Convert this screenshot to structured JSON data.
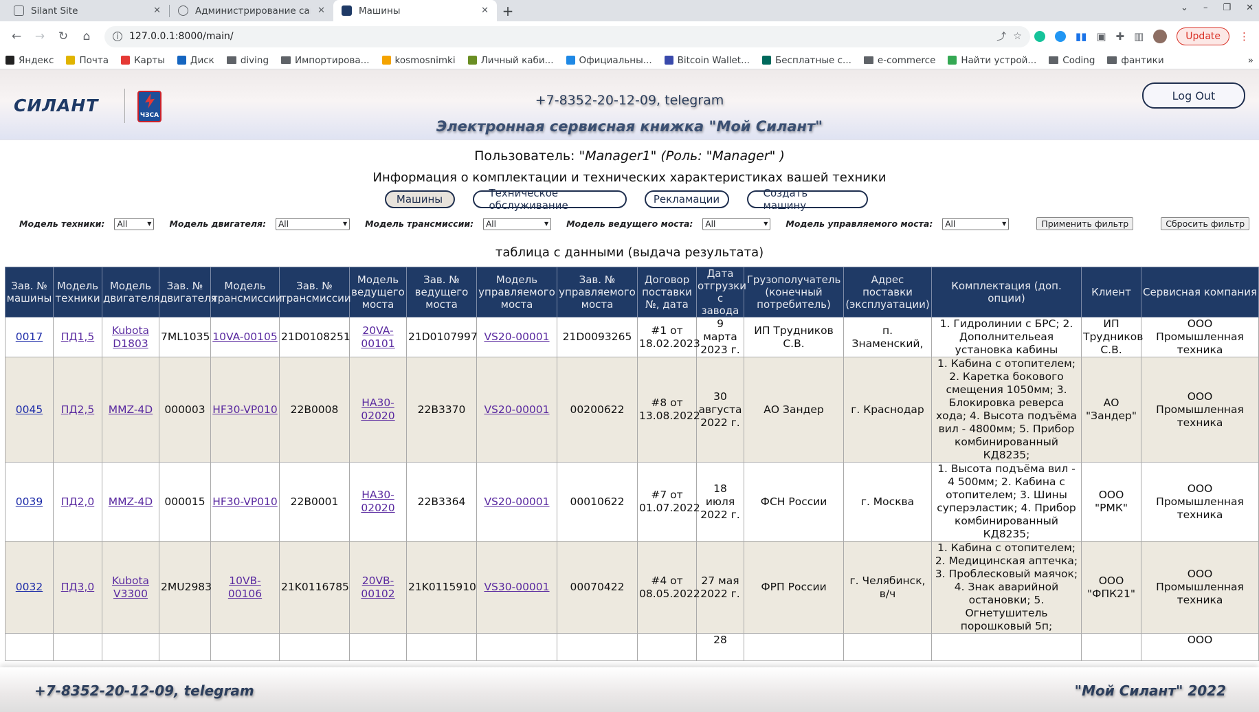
{
  "browser": {
    "tabs": [
      {
        "title": "Silant Site",
        "favicon": "document-icon",
        "active": false
      },
      {
        "title": "Администрирование сайта",
        "favicon": "globe-icon",
        "active": false
      },
      {
        "title": "Машины",
        "favicon": "silant-icon",
        "active": true
      }
    ],
    "url": "127.0.0.1:8000/main/",
    "update_label": "Update",
    "bookmarks": [
      {
        "label": "Яндекс",
        "color": "#222"
      },
      {
        "label": "Почта",
        "color": "#e0b400"
      },
      {
        "label": "Карты",
        "color": "#e53935"
      },
      {
        "label": "Диск",
        "color": "#1565c0"
      },
      {
        "label": "diving",
        "color": "folder"
      },
      {
        "label": "Импортирова...",
        "color": "folder"
      },
      {
        "label": "kosmosnimki",
        "color": "#f4a300"
      },
      {
        "label": "Личный каби...",
        "color": "#6a8e23"
      },
      {
        "label": "Официальны...",
        "color": "#1e88e5"
      },
      {
        "label": "Bitcoin Wallet...",
        "color": "#3949ab"
      },
      {
        "label": "Бесплатные с...",
        "color": "#00695c"
      },
      {
        "label": "e-commerce",
        "color": "folder"
      },
      {
        "label": "Найти устрой...",
        "color": "#34a853"
      },
      {
        "label": "Coding",
        "color": "folder"
      },
      {
        "label": "фантики",
        "color": "folder"
      }
    ],
    "more": "»"
  },
  "header": {
    "logo_text": "СИЛАНТ",
    "badge_text": "ЧЗСА",
    "phone": "+7-8352-20-12-09, telegram",
    "subtitle": "Электронная сервисная книжка \"Мой Силант\"",
    "logout_label": "Log Out"
  },
  "user": {
    "prefix": "Пользователь:",
    "value": "\"Manager1\" (Роль: \"Manager\" )"
  },
  "info_title": "Информация о комплектации и технических характеристиках вашей техники",
  "nav": {
    "machines": "Машины",
    "maintenance": "Техническое обслуживание",
    "claims": "Рекламации",
    "create": "Создать машину"
  },
  "filters": {
    "model_label": "Модель техники:",
    "engine_label": "Модель двигателя:",
    "transmission_label": "Модель трансмиссии:",
    "drive_axle_label": "Модель ведущего моста:",
    "steer_axle_label": "Модель управляемого моста:",
    "selected": "All",
    "apply": "Применить фильтр",
    "reset": "Сбросить фильтр"
  },
  "table_caption": "таблица с данными (выдача результата)",
  "table": {
    "headers": [
      "Зав. № машины",
      "Модель техники",
      "Модель двигателя",
      "Зав. № двигателя",
      "Модель трансмиссии",
      "Зав. № трансмиссии",
      "Модель ведущего моста",
      "Зав. № ведущего моста",
      "Модель управляемого моста",
      "Зав. № управляемого моста",
      "Договор поставки №, дата",
      "Дата отгрузки с завода",
      "Грузополучатель (конечный потребитель)",
      "Адрес поставки (эксплуатации)",
      "Комплектация (доп. опции)",
      "Клиент",
      "Сервисная компания"
    ],
    "rows": [
      [
        "0017",
        "ПД1,5",
        "Kubota D1803",
        "7ML1035",
        "10VA-00105",
        "21D0108251",
        "20VA-00101",
        "21D0107997",
        "VS20-00001",
        "21D0093265",
        "#1 от 18.02.2023",
        "9 марта 2023 г.",
        "ИП Трудников С.В.",
        "п. Знаменский,",
        "1. Гидролинии с БРС; 2. Дополнительеая установка кабины",
        "ИП Трудников С.В.",
        "ООО Промышленная техника"
      ],
      [
        "0045",
        "ПД2,5",
        "MMZ-4D",
        "000003",
        "HF30-VP010",
        "22B0008",
        "HA30-02020",
        "22B3370",
        "VS20-00001",
        "00200622",
        "#8 от 13.08.2022",
        "30 августа 2022 г.",
        "АО Зандер",
        "г. Краснодар",
        "1. Кабина с отопителем; 2. Каретка бокового смещения 1050мм; 3. Блокировка реверса хода; 4. Высота подъёма вил - 4800мм; 5. Прибор комбинированный КД8235;",
        "АО \"Зандер\"",
        "ООО Промышленная техника"
      ],
      [
        "0039",
        "ПД2,0",
        "MMZ-4D",
        "000015",
        "HF30-VP010",
        "22B0001",
        "HA30-02020",
        "22B3364",
        "VS20-00001",
        "00010622",
        "#7 от 01.07.2022",
        "18 июля 2022 г.",
        "ФСН России",
        "г. Москва",
        "1. Высота подъёма вил - 4 500мм; 2. Кабина с отопителем; 3. Шины суперэластик; 4. Прибор комбинированный КД8235;",
        "ООО \"РМК\"",
        "ООО Промышленная техника"
      ],
      [
        "0032",
        "ПД3,0",
        "Kubota V3300",
        "2MU2983",
        "10VB-00106",
        "21K0116785",
        "20VB-00102",
        "21K0115910",
        "VS30-00001",
        "00070422",
        "#4 от 08.05.2022",
        "27 мая 2022 г.",
        "ФРП России",
        "г. Челябинск, в/ч",
        "1. Кабина с отопителем; 2. Медицинская аптечка; 3. Проблесковый маячок; 4. Знак аварийной остановки; 5. Огнетушитель порошковый 5п;",
        "ООО \"ФПК21\"",
        "ООО Промышленная техника"
      ],
      [
        "",
        "",
        "",
        "",
        "",
        "",
        "",
        "",
        "",
        "",
        "",
        "28",
        "",
        "",
        "",
        "",
        "ООО"
      ]
    ]
  },
  "footer": {
    "phone": "+7-8352-20-12-09, telegram",
    "copyright": "\"Мой Силант\" 2022"
  }
}
